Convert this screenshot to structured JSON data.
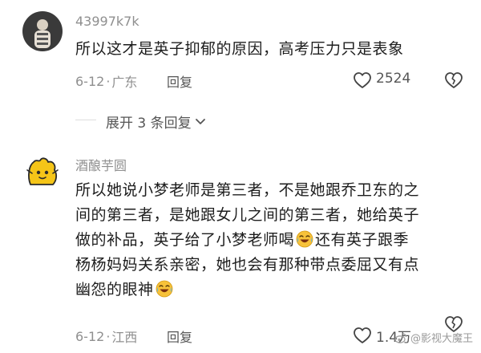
{
  "comments": [
    {
      "username": "43997k7k",
      "text_lines": [
        "所以这才是英子抑郁的原因，高考压力只是表象"
      ],
      "date": "6-12",
      "location": "广东",
      "reply_label": "回复",
      "like_count": "2524",
      "avatar_icon": "figure-avatar"
    },
    {
      "username": "酒酿芋圆",
      "text_lines": [
        "所以她说小梦老师是第三者，不是她跟乔卫东的之",
        "间的第三者，是她跟女儿之间的第三者，她给英子",
        "做的补品，英子给了小梦老师喝",
        "杨杨妈妈关系亲密，她也会有那种带点委屈又有点",
        "幽怨的眼神"
      ],
      "line3_suffix": "还有英子跟季",
      "date": "6-12",
      "location": "江西",
      "reply_label": "回复",
      "like_count": "1.4万",
      "avatar_icon": "yellow-character-avatar",
      "emoji_icon": "laughing-crying-emoji"
    }
  ],
  "expand_replies": {
    "label": "展开 3 条回复",
    "icon": "chevron-down-icon"
  },
  "separator": "·",
  "watermark": {
    "text": "@影视大魔王",
    "icon": "weibo-logo-icon"
  },
  "colors": {
    "meta": "#8f8f8f",
    "text": "#1d1d1d",
    "emoji_yellow": "#f7c23a",
    "avatar_yellow": "#f5c518"
  }
}
